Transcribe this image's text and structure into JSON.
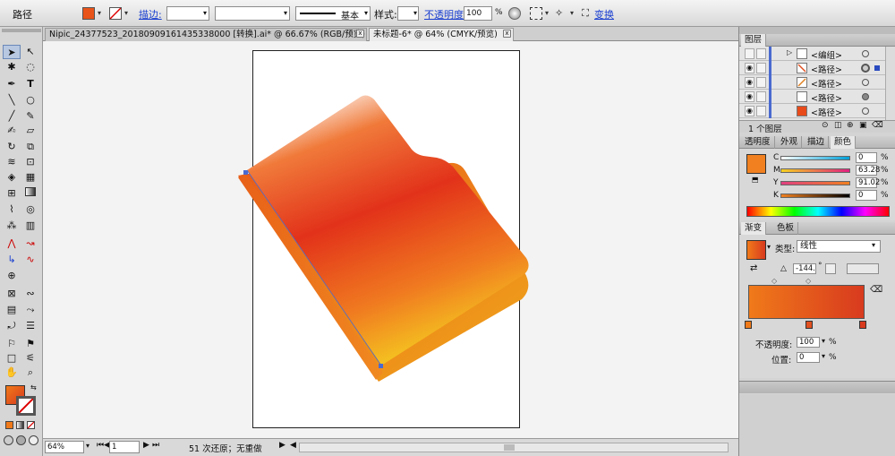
{
  "control": {
    "selection_type": "路径",
    "stroke_label": "描边:",
    "stroke_style": "基本",
    "style_label": "样式:",
    "opacity_label": "不透明度:",
    "opacity_value": "100",
    "opacity_unit": "%",
    "transform_label": "变换",
    "fill_color": "#e8541a"
  },
  "tabs": [
    {
      "label": "Nipic_24377523_20180909161435338000  [转换].ai* @ 66.67% (RGB/预览)",
      "close": "x"
    },
    {
      "label": "未标题-6* @ 64% (CMYK/预览)",
      "close": "x"
    }
  ],
  "status": {
    "zoom": "64%",
    "page": "1",
    "undo_text": "51 次还原；无重做"
  },
  "layers": {
    "tab": "图层",
    "rows": [
      {
        "name": "<编组>"
      },
      {
        "name": "<路径>"
      },
      {
        "name": "<路径>"
      },
      {
        "name": "<路径>"
      },
      {
        "name": "<路径>"
      }
    ],
    "footer": "1 个图层"
  },
  "color_panel": {
    "tabs": [
      "透明度",
      "外观",
      "描边",
      "颜色"
    ],
    "channels": [
      {
        "label": "C",
        "value": "0"
      },
      {
        "label": "M",
        "value": "63.28"
      },
      {
        "label": "Y",
        "value": "91.02"
      },
      {
        "label": "K",
        "value": "0"
      }
    ],
    "unit": "%",
    "swatch": "#f08020"
  },
  "gradient_panel": {
    "tabs": [
      "渐变",
      "色板"
    ],
    "type_label": "类型:",
    "type_value": "线性",
    "angle": "-144.",
    "angle_unit": "°",
    "opacity_label": "不透明度:",
    "opacity_value": "100",
    "position_label": "位置:",
    "position_value": "0",
    "unit": "%",
    "start_color": "#f07a1a",
    "end_color": "#d83a1e"
  }
}
